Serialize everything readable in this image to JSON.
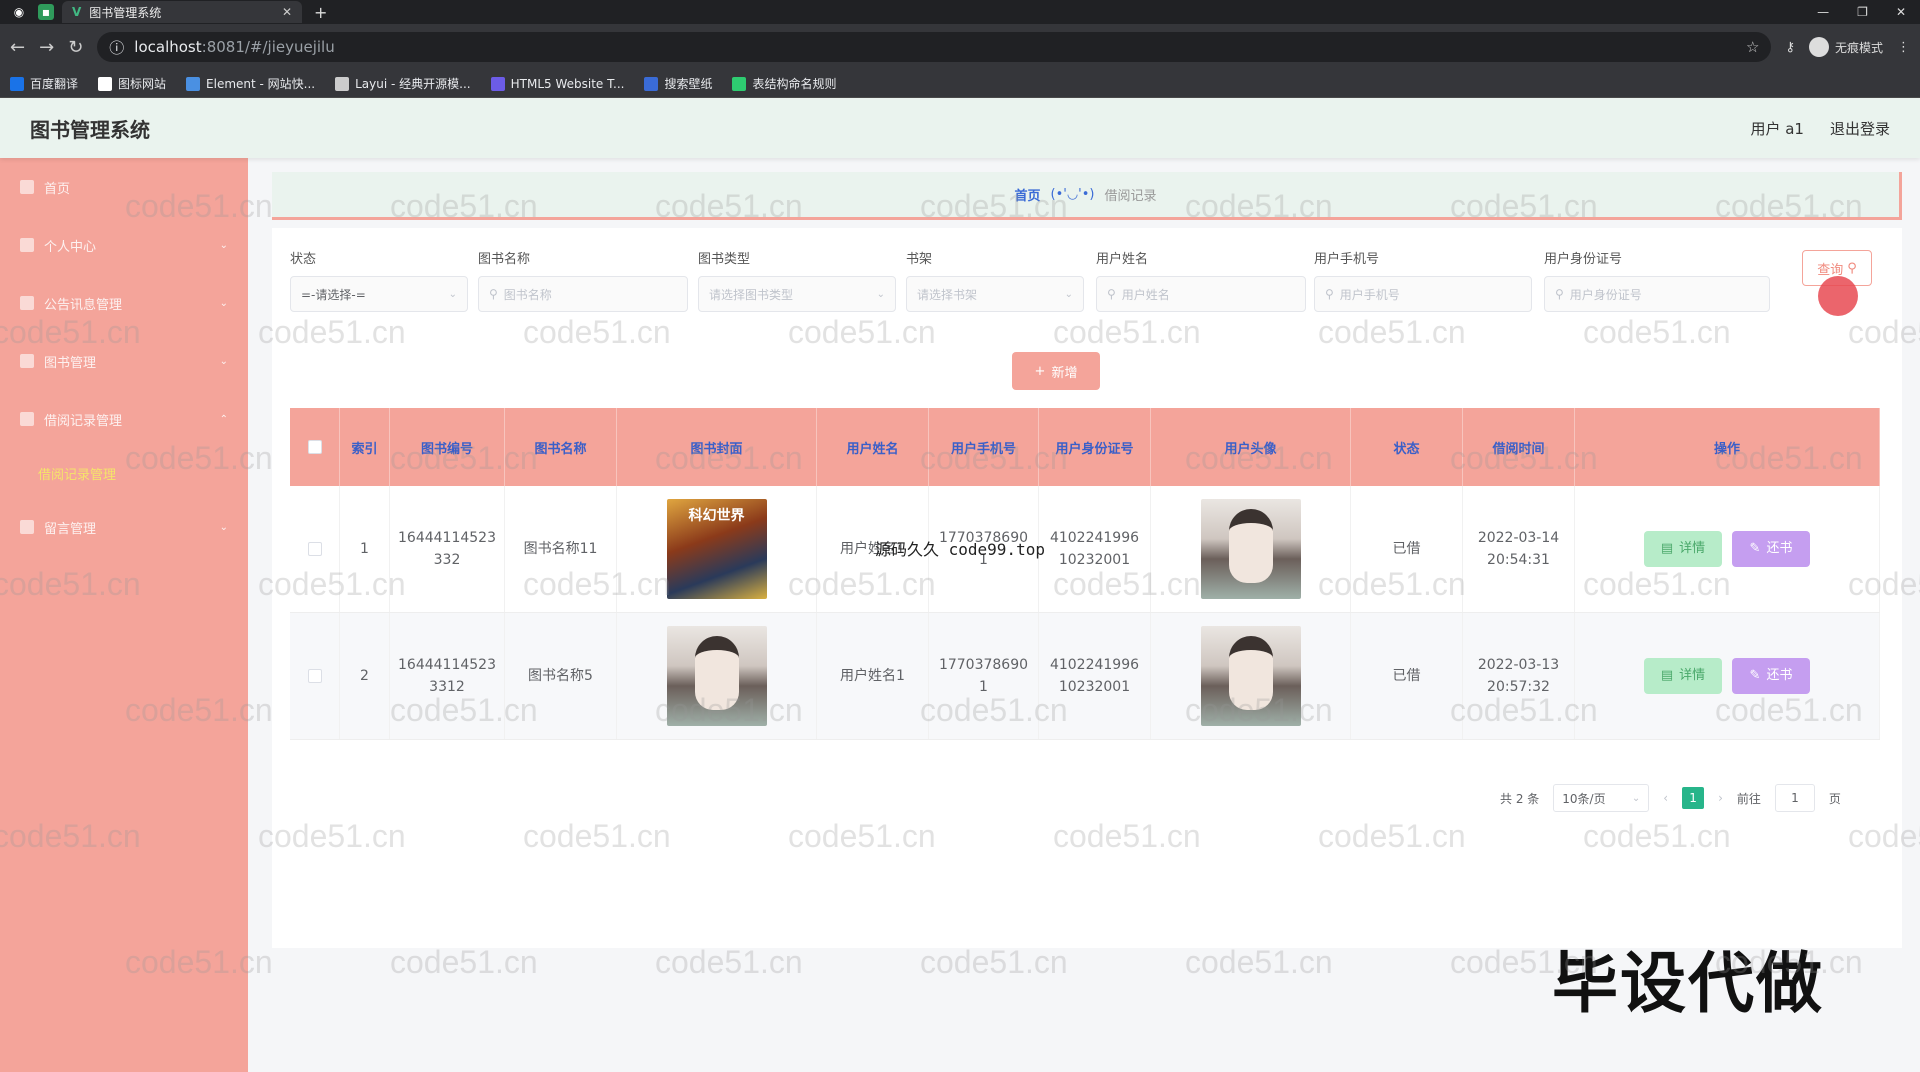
{
  "browser": {
    "tab_title": "图书管理系统",
    "url_host": "localhost",
    "url_path": ":8081/#/jieyuejilu",
    "incognito_label": "无痕模式",
    "bookmarks": [
      "百度翻译",
      "图标网站",
      "Element - 网站快...",
      "Layui - 经典开源模...",
      "HTML5 Website T...",
      "搜索壁纸",
      "表结构命名规则"
    ],
    "bookmark_colors": [
      "#1a73e8",
      "#ffffff",
      "#4a90e2",
      "#cccccc",
      "#6c5ce7",
      "#3a6bd6",
      "#2ecc71"
    ]
  },
  "header": {
    "title": "图书管理系统",
    "user": "用户 a1",
    "logout": "退出登录"
  },
  "sidebar": {
    "items": [
      {
        "label": "首页",
        "icon": "home-icon"
      },
      {
        "label": "个人中心",
        "icon": "user-icon"
      },
      {
        "label": "公告讯息管理",
        "icon": "notice-icon"
      },
      {
        "label": "图书管理",
        "icon": "book-icon"
      },
      {
        "label": "借阅记录管理",
        "icon": "record-icon"
      },
      {
        "label": "留言管理",
        "icon": "message-icon"
      }
    ],
    "active_sub": "借阅记录管理"
  },
  "breadcrumb": {
    "home": "首页",
    "sep": "(•'◡'•)",
    "current": "借阅记录"
  },
  "filters": {
    "status": {
      "label": "状态",
      "value": "=-请选择-="
    },
    "book_name": {
      "label": "图书名称",
      "placeholder": "图书名称"
    },
    "book_type": {
      "label": "图书类型",
      "placeholder": "请选择图书类型"
    },
    "shelf": {
      "label": "书架",
      "placeholder": "请选择书架"
    },
    "user_name": {
      "label": "用户姓名",
      "placeholder": "用户姓名"
    },
    "user_phone": {
      "label": "用户手机号",
      "placeholder": "用户手机号"
    },
    "user_id": {
      "label": "用户身份证号",
      "placeholder": "用户身份证号"
    },
    "search_label": "查询"
  },
  "add_label": "新增",
  "table": {
    "columns": [
      "索引",
      "图书编号",
      "图书名称",
      "图书封面",
      "用户姓名",
      "用户手机号",
      "用户身份证号",
      "用户头像",
      "状态",
      "借阅时间",
      "操作"
    ],
    "rows": [
      {
        "index": "1",
        "book_no": "16444114523 332",
        "book_name": "图书名称11",
        "cover_text": "科幻世界",
        "user_name": "用户姓名1",
        "phone": "1770378690 1",
        "id_no": "4102241996 10232001",
        "status": "已借",
        "time": "2022-03-14 20:54:31"
      },
      {
        "index": "2",
        "book_no": "16444114523 3312",
        "book_name": "图书名称5",
        "cover_text": "",
        "user_name": "用户姓名1",
        "phone": "1770378690 1",
        "id_no": "4102241996 10232001",
        "status": "已借",
        "time": "2022-03-13 20:57:32"
      }
    ],
    "detail_label": "详情",
    "return_label": "还书"
  },
  "pager": {
    "total": "共 2 条",
    "page_size": "10条/页",
    "current": "1",
    "goto": "前往",
    "goto_value": "1",
    "page_unit": "页"
  },
  "overlay_text": "源码久久 code99.top",
  "promo": "毕设代做",
  "watermark": "code51.cn"
}
